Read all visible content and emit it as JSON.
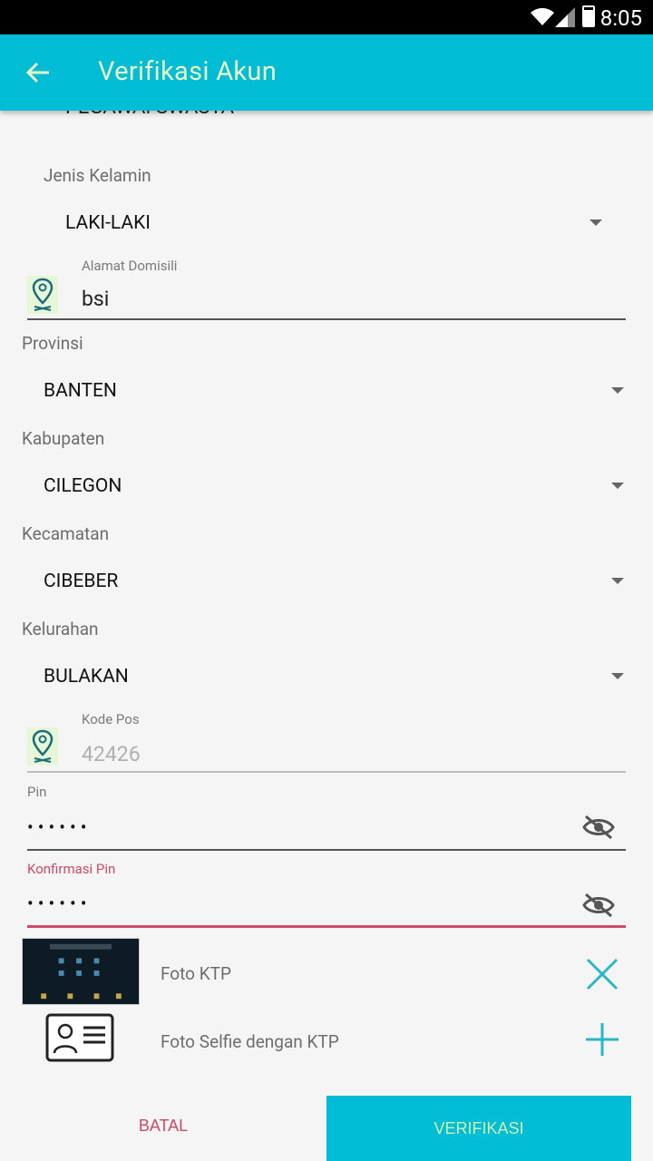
{
  "status_bar": {
    "time": "8:05"
  },
  "app_bar": {
    "title": "Verifikasi Akun"
  },
  "form": {
    "cut_off_value": "PEGAWAI SWASTA",
    "gender": {
      "label": "Jenis Kelamin",
      "value": "LAKI-LAKI"
    },
    "address": {
      "label": "Alamat Domisili",
      "value": "bsi"
    },
    "province": {
      "label": "Provinsi",
      "value": "BANTEN"
    },
    "regency": {
      "label": "Kabupaten",
      "value": "CILEGON"
    },
    "district": {
      "label": "Kecamatan",
      "value": "CIBEBER"
    },
    "village": {
      "label": "Kelurahan",
      "value": "BULAKAN"
    },
    "postal_code": {
      "label": "Kode Pos",
      "placeholder": "42426"
    },
    "pin": {
      "label": "Pin",
      "value": "••••••"
    },
    "pin_confirm": {
      "label": "Konfirmasi Pin",
      "value": "••••••"
    }
  },
  "photos": {
    "ktp_label": "Foto KTP",
    "selfie_label": "Foto Selfie dengan KTP"
  },
  "buttons": {
    "cancel": "BATAL",
    "verify": "VERIFIKASI"
  },
  "colors": {
    "primary": "#00bcd4",
    "accent_error": "#d04a67",
    "title_text": "#e9f8c7"
  },
  "icons": [
    "wifi-icon",
    "signal-icon",
    "battery-icon",
    "back-arrow-icon",
    "location-pin-icon",
    "eye-off-icon",
    "close-icon",
    "plus-icon",
    "id-card-icon"
  ]
}
